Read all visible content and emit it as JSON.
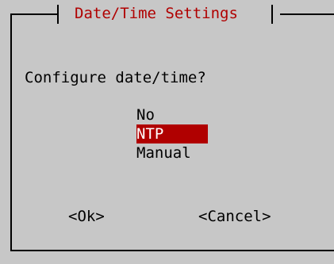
{
  "dialog": {
    "title": "Date/Time Settings",
    "prompt": "Configure date/time?",
    "options": [
      {
        "label": "No",
        "selected": false
      },
      {
        "label": "NTP",
        "selected": true
      },
      {
        "label": "Manual",
        "selected": false
      }
    ],
    "buttons": {
      "ok": "<Ok>",
      "cancel": "<Cancel>"
    }
  },
  "colors": {
    "background": "#c7c7c7",
    "accent": "#b00000",
    "text": "#000000",
    "selected_text": "#ffffff"
  }
}
